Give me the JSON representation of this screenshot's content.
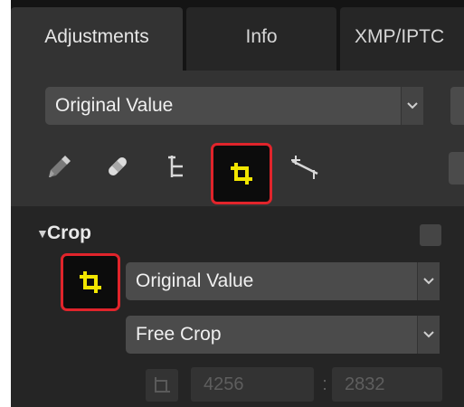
{
  "tabs": [
    {
      "label": "Adjustments",
      "active": true
    },
    {
      "label": "Info",
      "active": false
    },
    {
      "label": "XMP/IPTC",
      "active": false
    }
  ],
  "preset_dropdown": {
    "value": "Original Value"
  },
  "toolbar": {
    "icons": [
      "eyedropper-icon",
      "bandage-icon",
      "tree-icon",
      "crop-icon",
      "straighten-icon"
    ],
    "selected": "crop-icon"
  },
  "crop_section": {
    "title": "Crop",
    "value_dropdown": {
      "value": "Original Value"
    },
    "mode_dropdown": {
      "value": "Free Crop"
    },
    "width": "4256",
    "separator": ":",
    "height": "2832"
  },
  "colors": {
    "highlight": "#e0242b",
    "crop_icon": "#f2e600"
  }
}
